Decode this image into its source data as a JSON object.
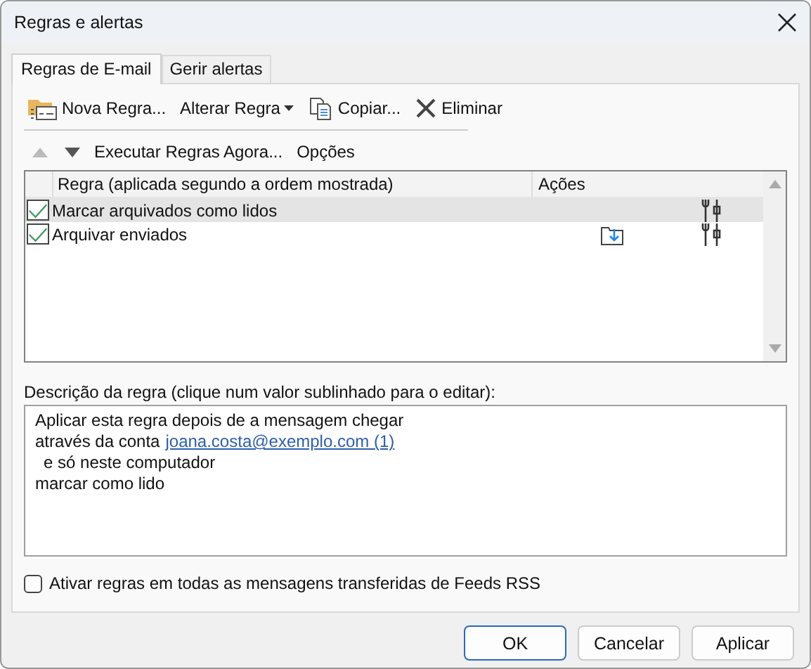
{
  "window": {
    "title": "Regras e alertas"
  },
  "tabs": [
    {
      "label": "Regras de E-mail",
      "selected": true
    },
    {
      "label": "Gerir alertas",
      "selected": false
    }
  ],
  "toolbar": [
    {
      "label": "Nova Regra...",
      "kind": "new"
    },
    {
      "label": "Alterar Regra",
      "kind": "menu"
    },
    {
      "label": "Copiar...",
      "kind": "copy"
    },
    {
      "label": "Eliminar",
      "kind": "delete"
    }
  ],
  "order_bar": {
    "move_up_disabled": true,
    "move_down_disabled": false,
    "run_rules": "Executar Regras Agora...",
    "options": "Opções"
  },
  "table": {
    "columns": [
      "Regra (aplicada segundo a ordem mostrada)",
      "Ações"
    ],
    "rows": [
      {
        "name": "Marcar arquivados como lidos",
        "checked": true,
        "selected": true,
        "move_action": false
      },
      {
        "name": "Arquivar enviados",
        "checked": true,
        "selected": false,
        "move_action": true
      }
    ]
  },
  "description": {
    "label": "Descrição da regra (clique num valor sublinhado para o editar):",
    "lines": [
      {
        "indent": false,
        "parts": [
          {
            "kind": "text",
            "text": "Aplicar esta regra depois de a mensagem chegar"
          }
        ]
      },
      {
        "indent": false,
        "parts": [
          {
            "kind": "text",
            "text": "através da conta"
          },
          {
            "kind": "link",
            "text": "joana.costa@exemplo.com (1)"
          }
        ]
      },
      {
        "indent": true,
        "parts": [
          {
            "kind": "text",
            "text": "e só neste computador"
          }
        ]
      },
      {
        "indent": false,
        "parts": [
          {
            "kind": "text",
            "text": "marcar como lido"
          }
        ]
      }
    ]
  },
  "rss_option": {
    "label": "Ativar regras em todas as mensagens transferidas de Feeds RSS",
    "checked": false
  },
  "buttons": [
    {
      "label": "OK",
      "default": true
    },
    {
      "label": "Cancelar",
      "default": false
    },
    {
      "label": "Aplicar",
      "default": false
    }
  ]
}
